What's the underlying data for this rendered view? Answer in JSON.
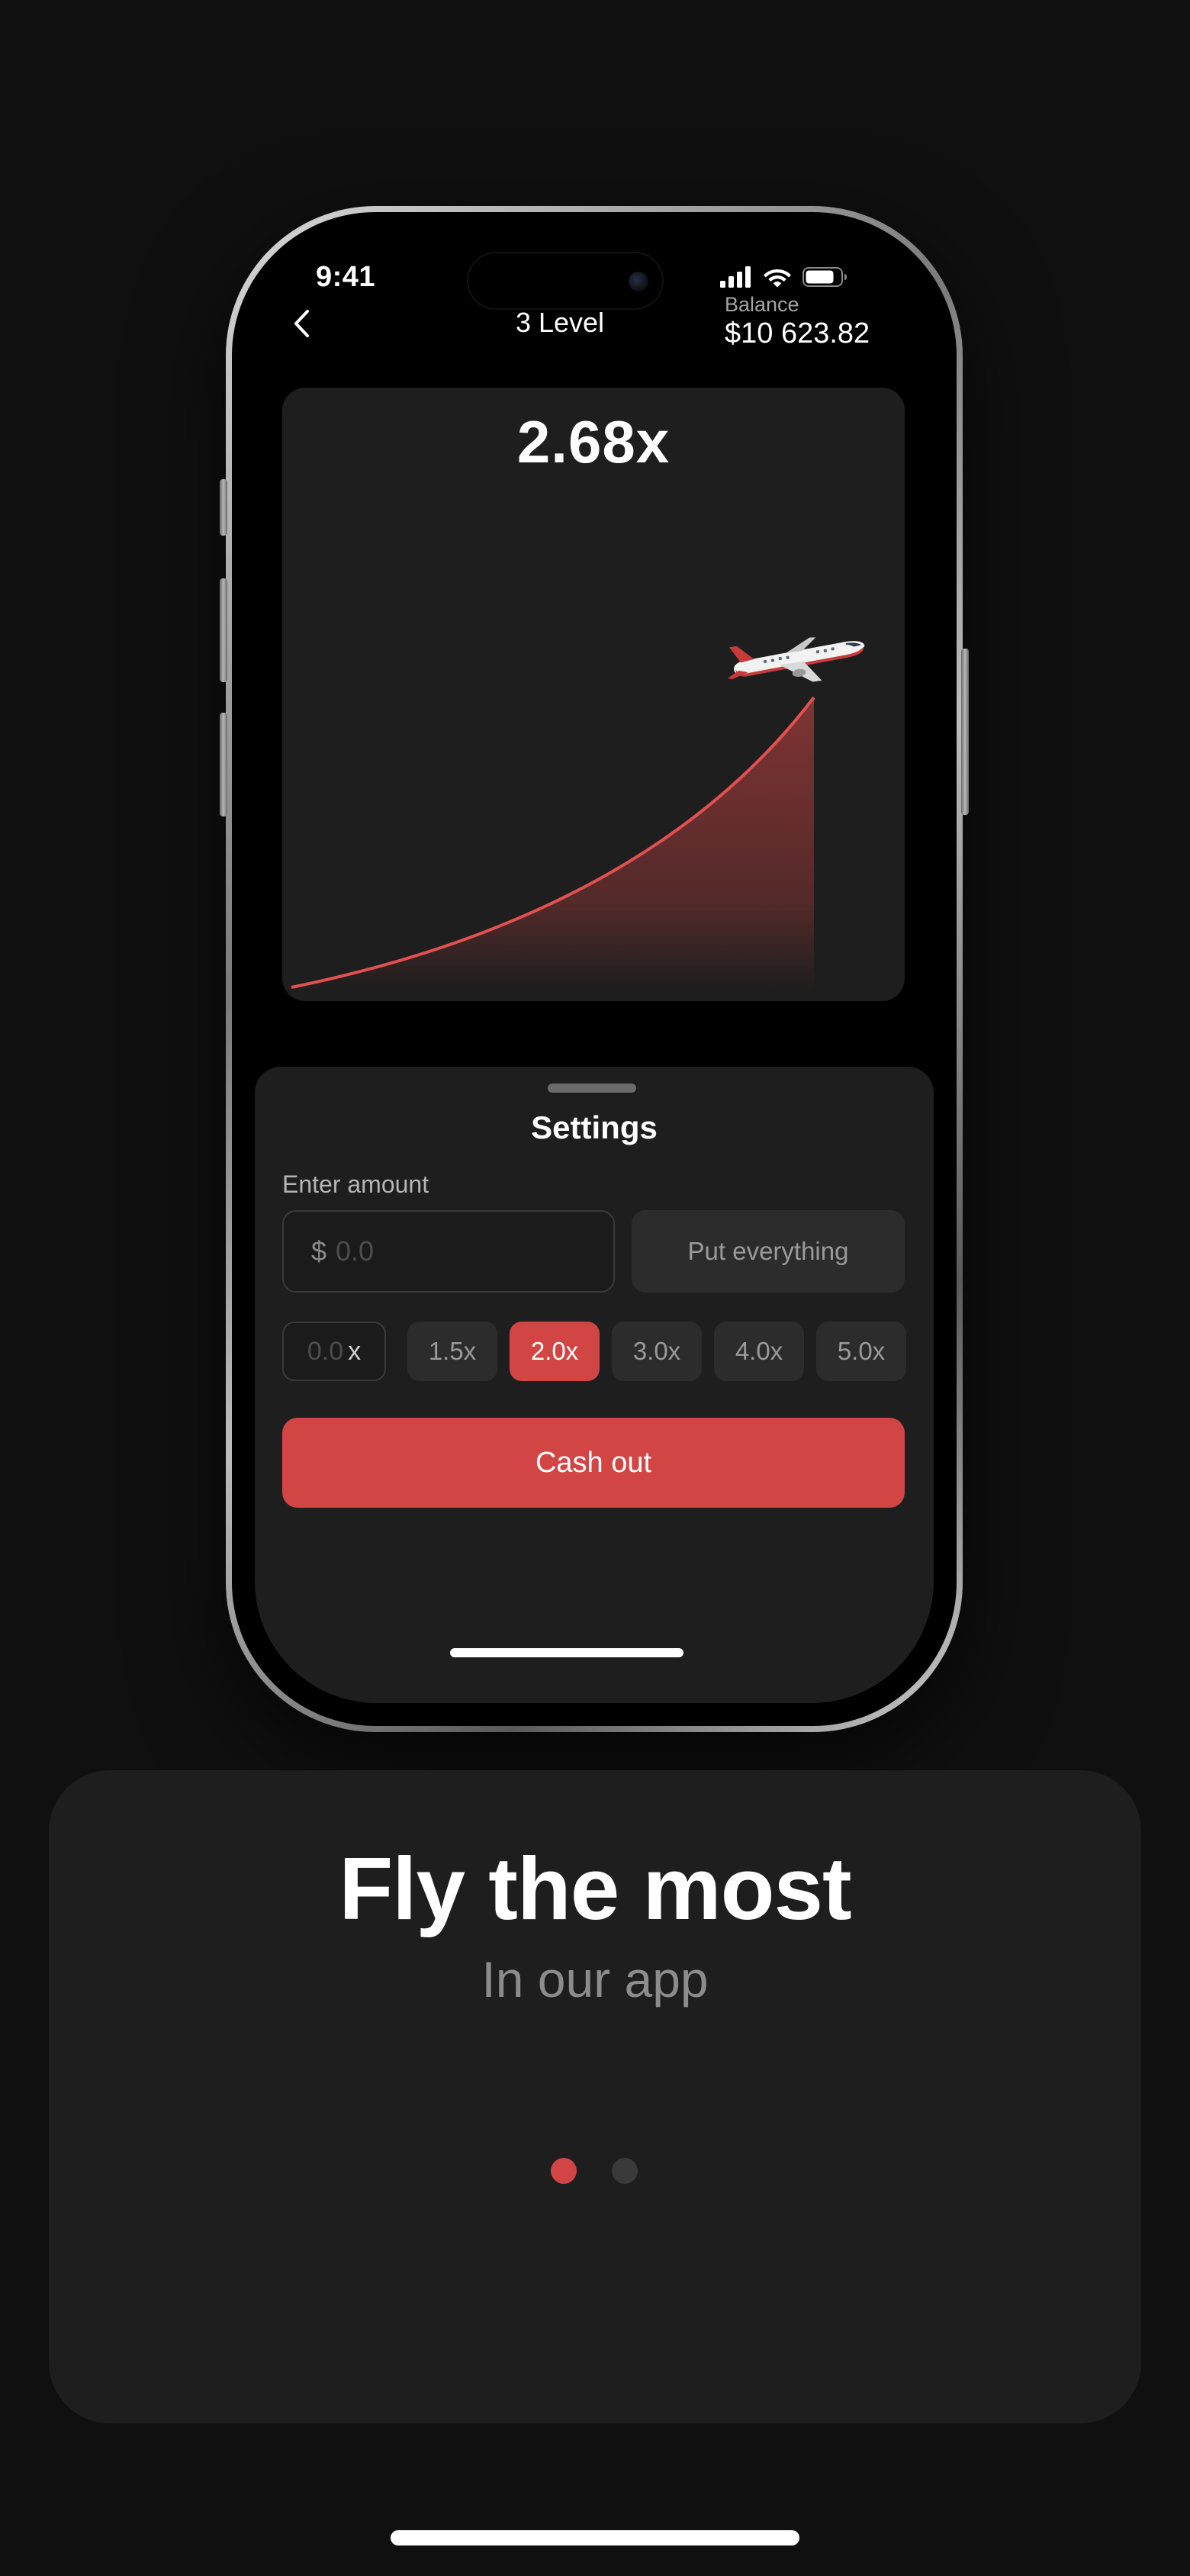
{
  "status_bar": {
    "time": "9:41",
    "icons": [
      "cellular-signal-icon",
      "wifi-icon",
      "battery-icon"
    ]
  },
  "nav": {
    "back_icon": "chevron-left-icon",
    "title": "3 Level",
    "balance_label": "Balance",
    "balance_value": "$10 623.82"
  },
  "game": {
    "multiplier": "2.68x",
    "plane_icon": "airplane-icon",
    "accent_color": "#d14545"
  },
  "settings": {
    "title": "Settings",
    "amount_label": "Enter amount",
    "currency_symbol": "$",
    "amount_value": "",
    "amount_placeholder": "0.0",
    "put_everything_label": "Put everything",
    "multiplier_input_placeholder": "0.0",
    "multiplier_input_suffix": "x",
    "multiplier_chips": [
      "1.5x",
      "2.0x",
      "3.0x",
      "4.0x",
      "5.0x"
    ],
    "selected_chip": "2.0x",
    "cash_out_label": "Cash out"
  },
  "promo": {
    "title": "Fly the most",
    "subtitle": "In our app",
    "page_count": 2,
    "active_page": 1
  },
  "colors": {
    "background": "#101010",
    "card": "#1e1e1e",
    "accent": "#d14545",
    "muted_text": "#8c8c8c"
  }
}
